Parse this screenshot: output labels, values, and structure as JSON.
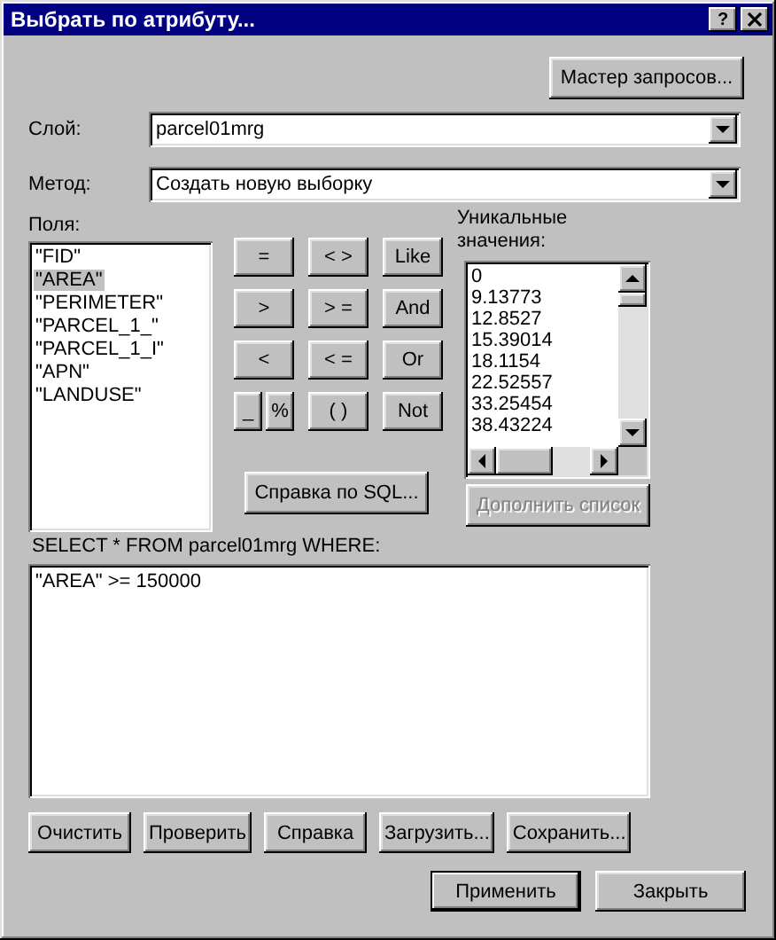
{
  "window": {
    "title": "Выбрать по атрибуту...",
    "help_button": "?"
  },
  "wizard_button": {
    "label": "Мастер запросов...",
    "disabled": false
  },
  "layer": {
    "label": "Слой:",
    "value": "parcel01mrg"
  },
  "method": {
    "label": "Метод:",
    "value": "Создать новую выборку"
  },
  "fields": {
    "label": "Поля:",
    "items": [
      {
        "text": "\"FID\"",
        "selected": false
      },
      {
        "text": "\"AREA\"",
        "selected": true
      },
      {
        "text": "\"PERIMETER\"",
        "selected": false
      },
      {
        "text": "\"PARCEL_1_\"",
        "selected": false
      },
      {
        "text": "\"PARCEL_1_I\"",
        "selected": false
      },
      {
        "text": "\"APN\"",
        "selected": false
      },
      {
        "text": "\"LANDUSE\"",
        "selected": false
      }
    ]
  },
  "operator_rows": [
    [
      {
        "label": "=",
        "kind": "full"
      },
      {
        "label": "< >",
        "kind": "full"
      },
      {
        "label": "Like",
        "kind": "full"
      }
    ],
    [
      {
        "label": ">",
        "kind": "full"
      },
      {
        "label": "> =",
        "kind": "full"
      },
      {
        "label": "And",
        "kind": "full"
      }
    ],
    [
      {
        "label": "<",
        "kind": "full"
      },
      {
        "label": "< =",
        "kind": "full"
      },
      {
        "label": "Or",
        "kind": "full"
      }
    ],
    [
      {
        "label": "_",
        "kind": "half"
      },
      {
        "label": "%",
        "kind": "half"
      },
      {
        "label": "( )",
        "kind": "full"
      },
      {
        "label": "Not",
        "kind": "full"
      }
    ]
  ],
  "sql_help_button": {
    "label": "Справка по SQL...",
    "disabled": false
  },
  "unique_values": {
    "label": "Уникальные значения:",
    "items": [
      {
        "text": "0",
        "selected": false
      },
      {
        "text": "9.13773",
        "selected": false
      },
      {
        "text": "12.8527",
        "selected": false
      },
      {
        "text": "15.39014",
        "selected": false
      },
      {
        "text": "18.1154",
        "selected": false
      },
      {
        "text": "22.52557",
        "selected": false
      },
      {
        "text": "33.25454",
        "selected": false
      },
      {
        "text": "38.43224",
        "selected": false
      }
    ]
  },
  "complete_list_button": {
    "label": "Дополнить список",
    "disabled": true
  },
  "query": {
    "label": "SELECT * FROM parcel01mrg WHERE:",
    "value": "\"AREA\" >= 150000"
  },
  "actions": [
    {
      "label": "Очистить",
      "disabled": false
    },
    {
      "label": "Проверить",
      "disabled": false
    },
    {
      "label": "Справка",
      "disabled": false
    },
    {
      "label": "Загрузить...",
      "disabled": false
    },
    {
      "label": "Сохранить...",
      "disabled": false
    }
  ],
  "footer_buttons": [
    {
      "label": "Применить",
      "default": true
    },
    {
      "label": "Закрыть",
      "default": false
    }
  ]
}
